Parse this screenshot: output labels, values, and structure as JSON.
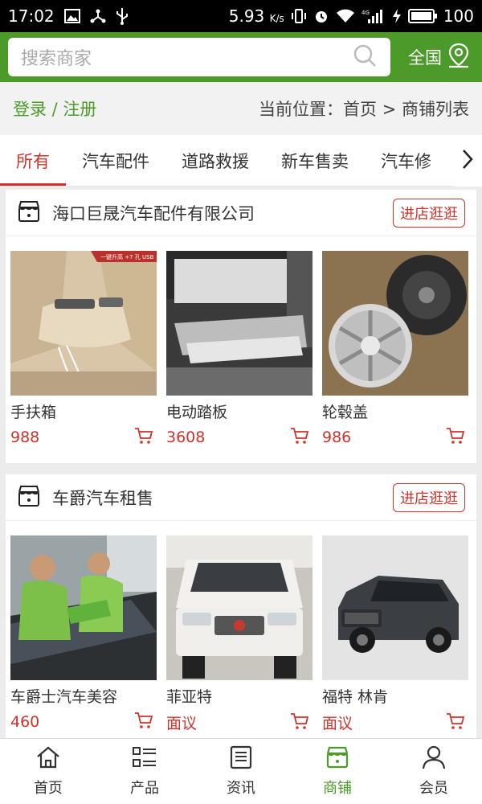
{
  "statusbar": {
    "time": "17:02",
    "speed": "5.93",
    "speed_unit": "K/s",
    "battery": "100"
  },
  "header": {
    "search_placeholder": "搜索商家",
    "region_label": "全国",
    "brand_color": "#4c9a2a"
  },
  "location": {
    "login_label": "登录 / 注册",
    "breadcrumb": "当前位置：首页 > 商铺列表"
  },
  "tabs": [
    {
      "label": "所有",
      "active": true
    },
    {
      "label": "汽车配件"
    },
    {
      "label": "道路救援"
    },
    {
      "label": "新车售卖"
    },
    {
      "label": "汽车修"
    }
  ],
  "shops": [
    {
      "name": "海口巨晟汽车配件有限公司",
      "visit_label": "进店逛逛",
      "products": [
        {
          "name": "手扶箱",
          "price": "988",
          "badge": "一键升高 +7 孔 USB"
        },
        {
          "name": "电动踏板",
          "price": "3608"
        },
        {
          "name": "轮毂盖",
          "price": "986"
        }
      ]
    },
    {
      "name": "车爵汽车租售",
      "visit_label": "进店逛逛",
      "products": [
        {
          "name": "车爵士汽车美容",
          "price": "460"
        },
        {
          "name": "菲亚特",
          "price": "面议"
        },
        {
          "name": "福特 林肯",
          "price": "面议"
        }
      ]
    }
  ],
  "bottom_nav": [
    {
      "label": "首页",
      "icon": "home-icon"
    },
    {
      "label": "产品",
      "icon": "grid-list-icon"
    },
    {
      "label": "资讯",
      "icon": "news-icon"
    },
    {
      "label": "商铺",
      "icon": "shop-icon",
      "active": true
    },
    {
      "label": "会员",
      "icon": "user-icon"
    }
  ],
  "accent_color": "#d0332a"
}
